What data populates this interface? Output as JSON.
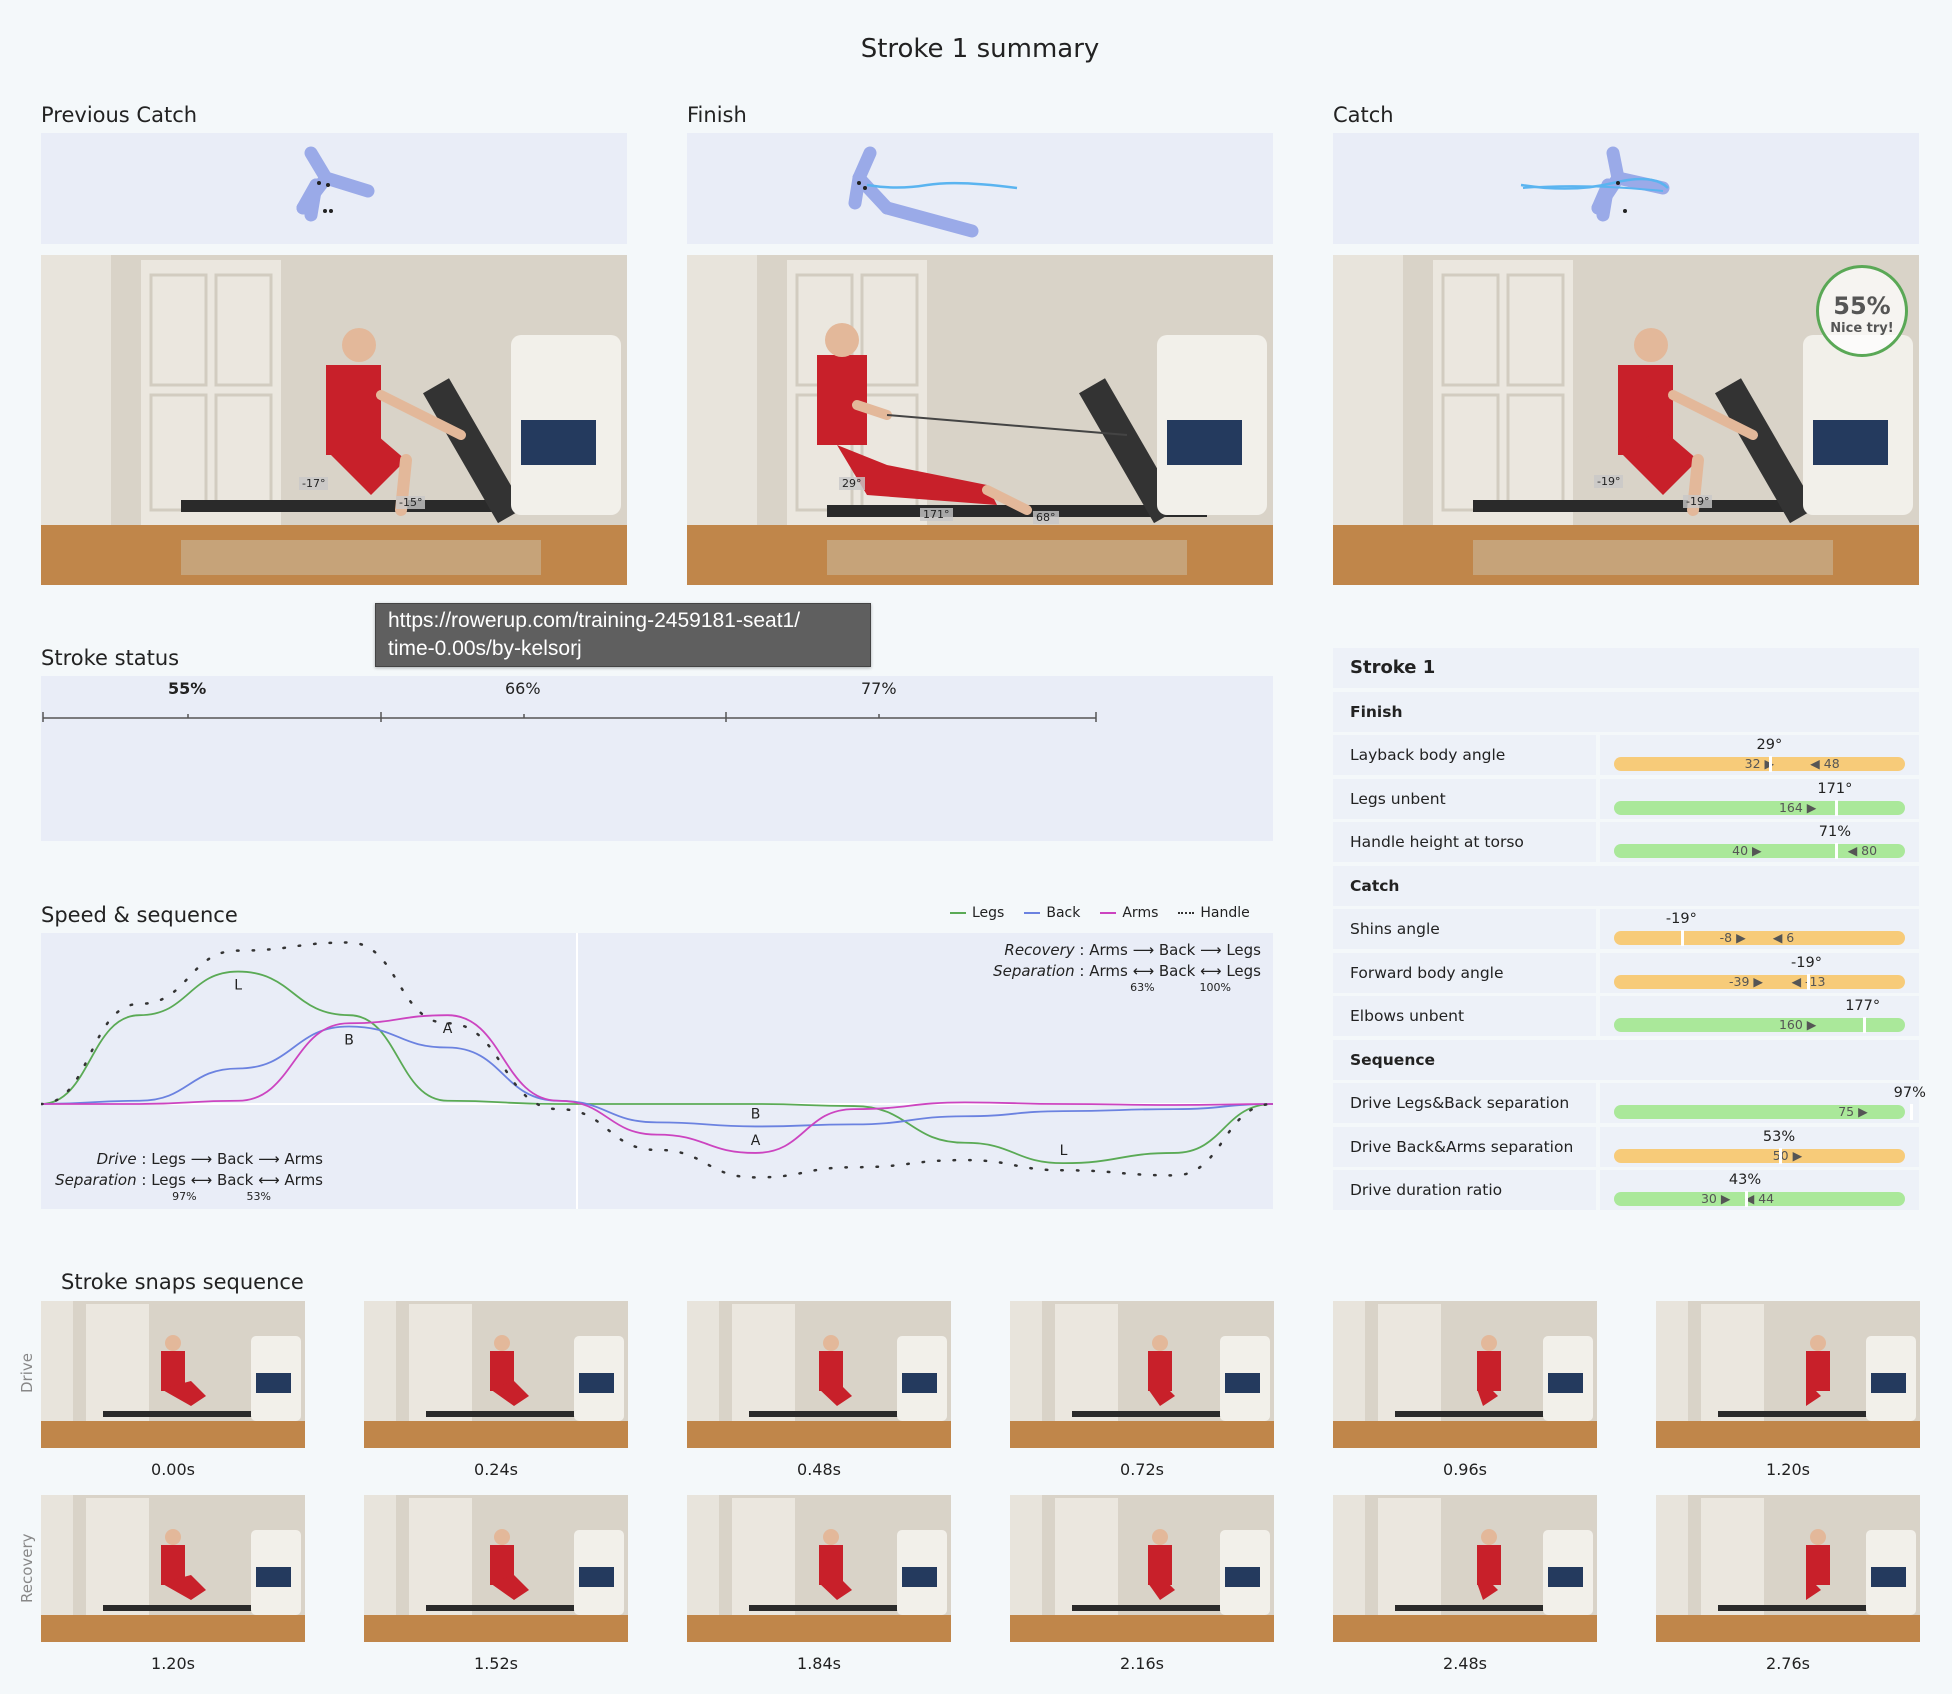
{
  "page": {
    "title": "Stroke 1 summary"
  },
  "poses": [
    {
      "label": "Previous Catch",
      "angle_a": "-17°",
      "angle_b": "-15°"
    },
    {
      "label": "Finish",
      "angle_a": "29°",
      "angle_b": "171°",
      "angle_c": "68°"
    },
    {
      "label": "Catch",
      "angle_a": "-19°",
      "angle_b": "-19°",
      "score": "55%",
      "score_message": "Nice try!"
    }
  ],
  "tooltip": {
    "line1": "https://rowerup.com/training-2459181-seat1/",
    "line2": "time-0.00s/by-kelsorj"
  },
  "status": {
    "label": "Stroke status",
    "segments": [
      {
        "label": "55%",
        "bold": true
      },
      {
        "label": "66%",
        "bold": false
      },
      {
        "label": "77%",
        "bold": false
      }
    ]
  },
  "metrics": {
    "title": "Stroke 1",
    "groups": [
      {
        "name": "Finish",
        "rows": [
          {
            "label": "Layback body angle",
            "value": "29°",
            "value_pos": 0.498,
            "color": "orange",
            "limits": [
              {
                "text": "32 ▶",
                "pos": 0.47
              },
              {
                "text": "◀ 48",
                "pos": 0.68
              }
            ]
          },
          {
            "label": "Legs unbent",
            "value": "171°",
            "value_pos": 0.708,
            "color": "green",
            "limits": [
              {
                "text": "164 ▶",
                "pos": 0.58
              }
            ]
          },
          {
            "label": "Handle height at torso",
            "value": "71%",
            "value_pos": 0.708,
            "color": "green",
            "limits": [
              {
                "text": "40 ▶",
                "pos": 0.43
              },
              {
                "text": "◀ 80",
                "pos": 0.8
              }
            ]
          }
        ]
      },
      {
        "name": "Catch",
        "rows": [
          {
            "label": "Shins angle",
            "value": "-19°",
            "value_pos": 0.216,
            "color": "orange",
            "limits": [
              {
                "text": "-8 ▶",
                "pos": 0.39
              },
              {
                "text": "◀ 6",
                "pos": 0.56
              }
            ]
          },
          {
            "label": "Forward body angle",
            "value": "-19°",
            "value_pos": 0.617,
            "color": "orange",
            "limits": [
              {
                "text": "-39 ▶",
                "pos": 0.42
              },
              {
                "text": "◀ -13",
                "pos": 0.62
              }
            ]
          },
          {
            "label": "Elbows unbent",
            "value": "177°",
            "value_pos": 0.797,
            "color": "green",
            "limits": [
              {
                "text": "160 ▶",
                "pos": 0.58
              }
            ]
          }
        ]
      },
      {
        "name": "Sequence",
        "rows": [
          {
            "label": "Drive Legs&Back separation",
            "value": "97%",
            "value_pos": 0.948,
            "color": "green",
            "limits": [
              {
                "text": "75 ▶",
                "pos": 0.77
              }
            ]
          },
          {
            "label": "Drive Back&Arms separation",
            "value": "53%",
            "value_pos": 0.529,
            "color": "orange",
            "limits": [
              {
                "text": "50 ▶",
                "pos": 0.56
              }
            ]
          },
          {
            "label": "Drive duration ratio",
            "value": "43%",
            "value_pos": 0.42,
            "color": "green",
            "limits": [
              {
                "text": "30 ▶",
                "pos": 0.33
              },
              {
                "text": "◀ 44",
                "pos": 0.47
              }
            ]
          }
        ]
      }
    ]
  },
  "chart_data": {
    "type": "line",
    "title": "Speed & sequence",
    "legend_position": "top-right",
    "series": [
      {
        "name": "Legs",
        "color": "#5aaa55",
        "x": [
          0,
          0.08,
          0.16,
          0.25,
          0.33,
          0.42,
          0.5,
          0.58,
          0.66,
          0.75,
          0.83,
          0.92,
          1.0
        ],
        "y": [
          0,
          0.55,
          0.82,
          0.55,
          0.02,
          0.0,
          0.0,
          0.0,
          -0.02,
          -0.38,
          -0.58,
          -0.48,
          0
        ]
      },
      {
        "name": "Back",
        "color": "#6b82e0",
        "x": [
          0,
          0.08,
          0.16,
          0.25,
          0.33,
          0.42,
          0.5,
          0.58,
          0.66,
          0.75,
          0.83,
          0.92,
          1.0
        ],
        "y": [
          0,
          0.02,
          0.22,
          0.48,
          0.35,
          0.02,
          -0.18,
          -0.22,
          -0.2,
          -0.12,
          -0.07,
          -0.05,
          0
        ]
      },
      {
        "name": "Arms",
        "color": "#cc44c0",
        "x": [
          0,
          0.08,
          0.16,
          0.25,
          0.33,
          0.42,
          0.5,
          0.58,
          0.66,
          0.75,
          0.83,
          0.92,
          1.0
        ],
        "y": [
          0,
          0.0,
          0.02,
          0.5,
          0.55,
          0.02,
          -0.3,
          -0.48,
          -0.05,
          0.01,
          0.0,
          -0.01,
          0
        ]
      },
      {
        "name": "Handle",
        "color": "#333333",
        "x": [
          0,
          0.08,
          0.16,
          0.25,
          0.33,
          0.42,
          0.5,
          0.58,
          0.66,
          0.75,
          0.83,
          0.92,
          1.0
        ],
        "y": [
          0,
          0.62,
          0.95,
          1.0,
          0.5,
          -0.05,
          -0.45,
          -0.72,
          -0.62,
          -0.55,
          -0.65,
          -0.7,
          0
        ]
      }
    ],
    "peak_labels": [
      {
        "text": "L",
        "series": "Legs"
      },
      {
        "text": "B",
        "series": "Back"
      },
      {
        "text": "A",
        "series": "Arms"
      },
      {
        "text": "B",
        "series": "Back"
      },
      {
        "text": "A",
        "series": "Arms"
      },
      {
        "text": "L",
        "series": "Legs"
      }
    ],
    "drive": {
      "label": "Drive",
      "order": [
        "Legs",
        "Back",
        "Arms"
      ],
      "separation_label": "Separation",
      "separations": [
        "97%",
        "53%"
      ]
    },
    "recovery": {
      "label": "Recovery",
      "order": [
        "Arms",
        "Back",
        "Legs"
      ],
      "separation_label": "Separation",
      "separations": [
        "63%",
        "100%"
      ]
    }
  },
  "snaps": {
    "title": "Stroke snaps sequence",
    "drive_label": "Drive",
    "recovery_label": "Recovery",
    "drive_times": [
      "0.00s",
      "0.24s",
      "0.48s",
      "0.72s",
      "0.96s",
      "1.20s"
    ],
    "recovery_times": [
      "1.20s",
      "1.52s",
      "1.84s",
      "2.16s",
      "2.48s",
      "2.76s"
    ]
  },
  "colors": {
    "panel": "#e9edf7",
    "green": "#aae89a",
    "orange": "#f7cb79",
    "pose_blue": "#9aaae8",
    "badge_ring": "#5aa856"
  }
}
